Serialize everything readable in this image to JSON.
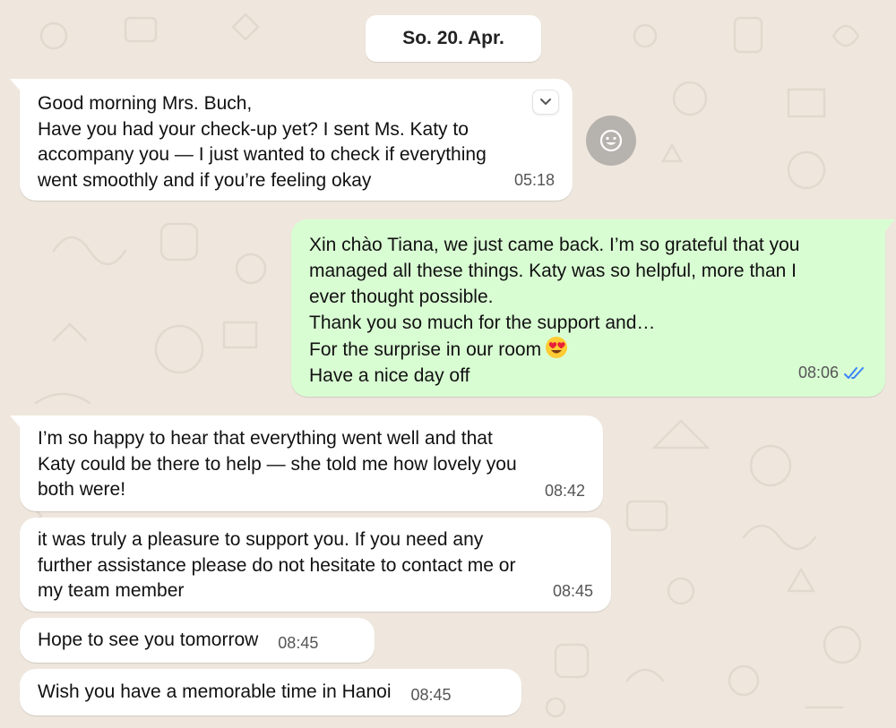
{
  "date_chip": "So. 20. Apr.",
  "messages": [
    {
      "direction": "incoming",
      "lines": [
        "Good morning Mrs. Buch,",
        "Have you had your check-up yet? I sent Ms. Katy to",
        "accompany you — I just wanted to check if everything",
        "went smoothly and if you’re feeling okay"
      ],
      "time": "05:18"
    },
    {
      "direction": "outgoing",
      "lines": [
        "Xin chào Tiana, we just came back. I’m so grateful that you",
        "managed all these things. Katy was so helpful, more than I",
        "ever thought possible.",
        "Thank you so much for the support and…",
        "For the surprise in our room",
        "Have a nice day off"
      ],
      "emoji": "smiling-face-heart-eyes",
      "time": "08:06",
      "status": "read"
    },
    {
      "direction": "incoming",
      "lines": [
        "I’m so happy to hear that everything went well and that",
        "Katy could be there to help — she told me how lovely you",
        "both were!"
      ],
      "time": "08:42"
    },
    {
      "direction": "incoming",
      "lines": [
        "it was truly a pleasure to support you. If you need any",
        "further assistance please do not hesitate to contact me or",
        "my team member"
      ],
      "time": "08:45"
    },
    {
      "direction": "incoming",
      "lines": [
        "Hope to see you tomorrow"
      ],
      "time": "08:45"
    },
    {
      "direction": "incoming",
      "lines": [
        "Wish you have a memorable time in Hanoi"
      ],
      "time": "08:45"
    }
  ],
  "icons": {
    "menu": "chevron-down-icon",
    "reaction": "emoji-reaction-icon",
    "read_receipt": "double-check-icon"
  },
  "colors": {
    "wallpaper": "#efe7dd",
    "incoming_bubble": "#ffffff",
    "outgoing_bubble": "#d9fdd3",
    "read_tick": "#3b82f6"
  }
}
